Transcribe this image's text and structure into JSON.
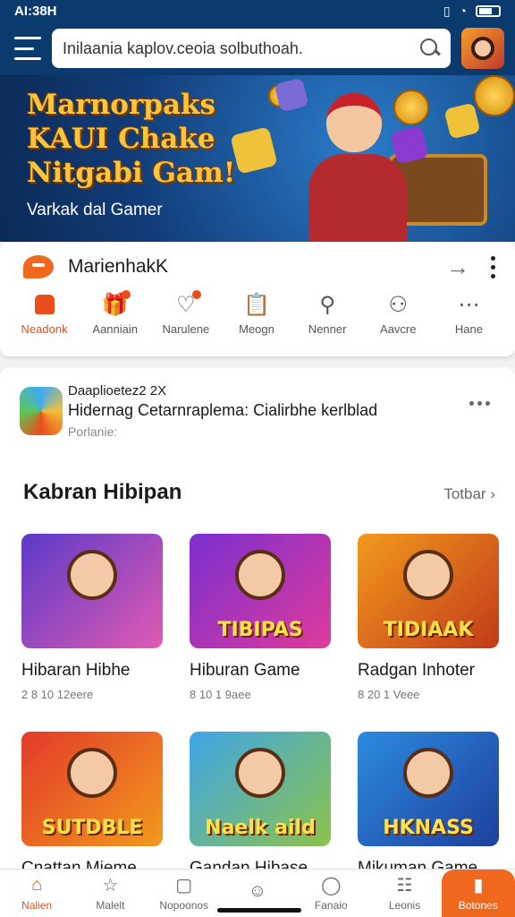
{
  "status": {
    "time": "AI:38H",
    "battery": ""
  },
  "header": {
    "search_value": "Inilaania kaplov.ceoia solbuthoah."
  },
  "banner": {
    "title": "Marnorpaks\nKAUI Chake\nNitgabi Gam!",
    "subtitle": "Varkak dal Gamer"
  },
  "app": {
    "name": "MarienhakK",
    "categories": [
      {
        "label": "Neadonk",
        "icon": "home-icon",
        "active": true
      },
      {
        "label": "Aanniain",
        "icon": "gift-icon"
      },
      {
        "label": "Narulene",
        "icon": "heart-location-icon"
      },
      {
        "label": "Meogn",
        "icon": "clipboard-icon"
      },
      {
        "label": "Nenner",
        "icon": "search-icon"
      },
      {
        "label": "Aavcre",
        "icon": "person-icon"
      },
      {
        "label": "Hane",
        "icon": "more-grid-icon"
      }
    ]
  },
  "notice": {
    "title": "Daaplioetez2 2X",
    "text": "Hidernag Cetarnraplema: Cialirbhe kerlblad",
    "sub": "Porlanie:"
  },
  "section": {
    "title": "Kabran Hibipan",
    "link": "Totbar"
  },
  "games": [
    {
      "name": "Hibaran Hibhe",
      "meta": "2 8 10 12eere",
      "badge": "",
      "colors": [
        "#5b3ac9",
        "#e05ab1"
      ]
    },
    {
      "name": "Hiburan Game",
      "meta": "8 10 1 9aee",
      "badge": "TIBIPAS",
      "colors": [
        "#7a2fd0",
        "#e03a9b"
      ]
    },
    {
      "name": "Radgan Inhoter",
      "meta": "8 20 1 Veee",
      "badge": "TIDIAAK",
      "colors": [
        "#f29a1d",
        "#c23a1a"
      ]
    },
    {
      "name": "Cnattan Mieme",
      "meta": "",
      "badge": "SUTDBLE",
      "colors": [
        "#e23a2a",
        "#f29a1d"
      ]
    },
    {
      "name": "Gandan Hibase",
      "meta": "",
      "badge": "Naelk aild",
      "colors": [
        "#3fa5e8",
        "#8bc34a"
      ]
    },
    {
      "name": "Mikuman Game",
      "meta": "",
      "badge": "HKNASS",
      "colors": [
        "#2b8be0",
        "#1e3f9e"
      ]
    }
  ],
  "bottom_nav": [
    {
      "label": "Nalien",
      "icon": "home-icon",
      "active": true
    },
    {
      "label": "Malelt",
      "icon": "star-icon"
    },
    {
      "label": "Nopoonos",
      "icon": "square-icon"
    },
    {
      "label": "",
      "icon": "smiley-icon"
    },
    {
      "label": "Fanaio",
      "icon": "chat-icon"
    },
    {
      "label": "Leonis",
      "icon": "gamepad-icon"
    },
    {
      "label": "Botones",
      "icon": "bookmark-icon",
      "cta": true
    }
  ],
  "colors": {
    "brand": "#e94e1b",
    "header_bg": "#0b3a6e",
    "cta": "#f0671e"
  }
}
